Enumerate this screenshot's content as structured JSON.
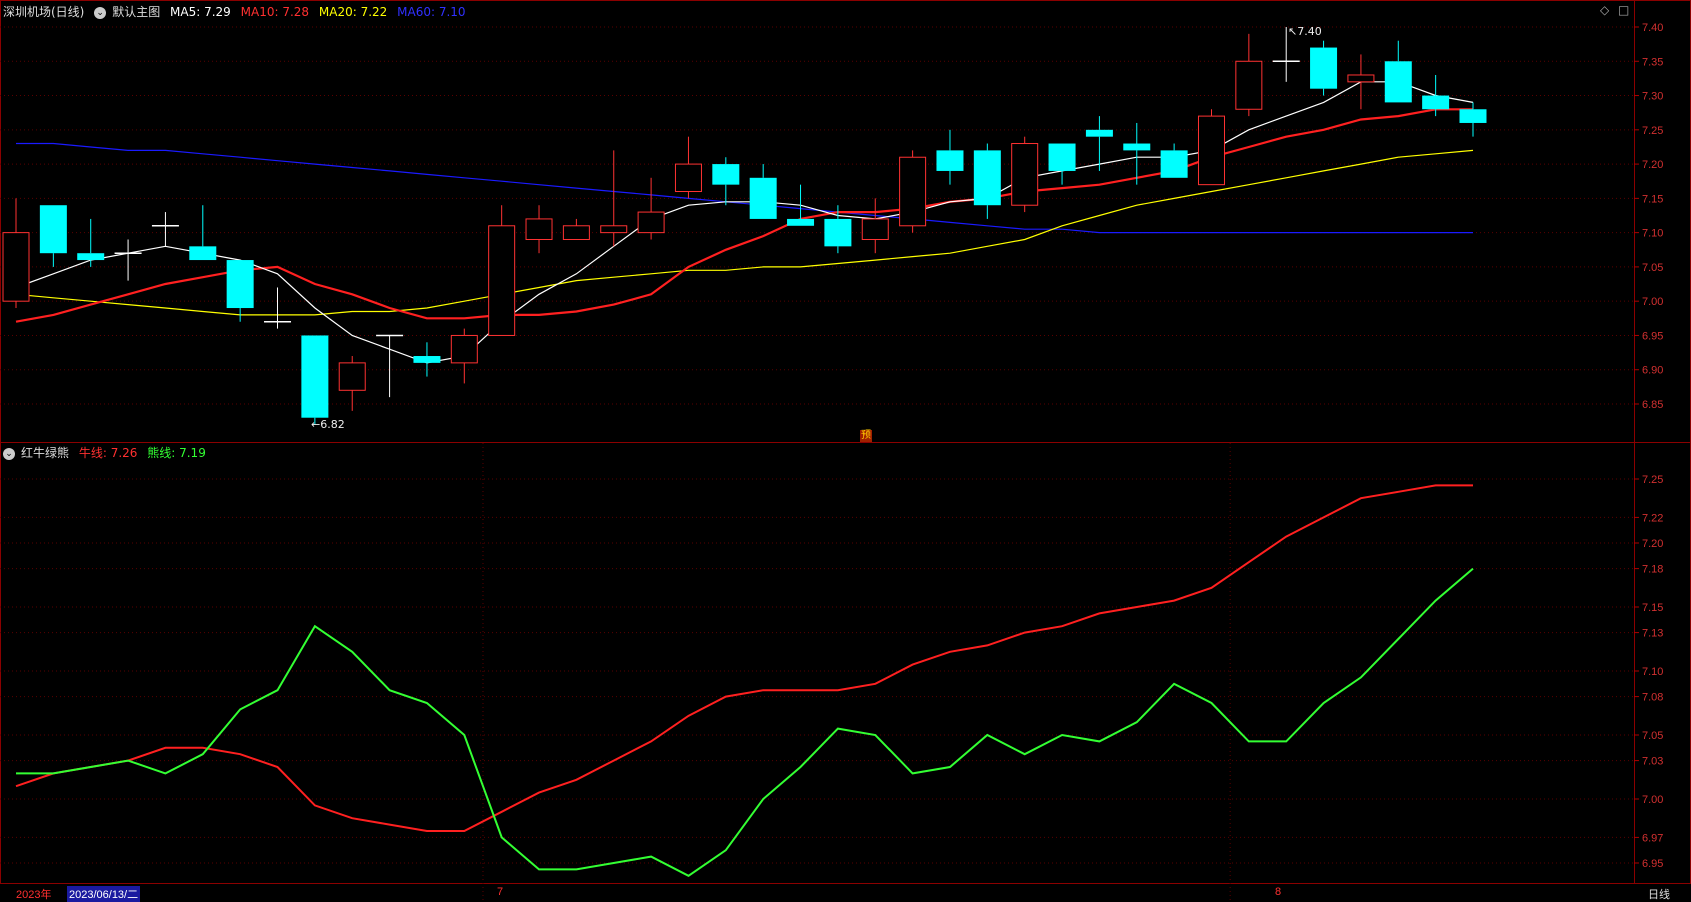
{
  "header_main": {
    "stock": "深圳机场(日线)",
    "template": "默认主图",
    "ma5": "MA5: 7.29",
    "ma10": "MA10: 7.28",
    "ma20": "MA20: 7.22",
    "ma60": "MA60: 7.10"
  },
  "header_sub": {
    "indicator": "红牛绿熊",
    "bull": "牛线: 7.26",
    "bear": "熊线: 7.19"
  },
  "annotations": {
    "high": "7.40",
    "low": "6.82",
    "pre": "预"
  },
  "footer": {
    "year": "2023年",
    "cursor_date": "2023/06/13/二",
    "month7": "7",
    "month8": "8",
    "period": "日线"
  },
  "chart_data": [
    {
      "type": "candlestick",
      "ylim": [
        6.8,
        7.43
      ],
      "yticks": [
        "7.40",
        "7.35",
        "7.30",
        "7.25",
        "7.20",
        "7.15",
        "7.10",
        "7.05",
        "7.00",
        "6.95",
        "6.90",
        "6.85"
      ],
      "colors": {
        "up": "#ff3232",
        "down": "#00ffff",
        "ma5": "#ffffff",
        "ma10": "#ff2020",
        "ma20": "#ffff00",
        "ma60": "#1a1aff"
      },
      "candles": [
        {
          "o": 7.0,
          "h": 7.15,
          "l": 6.99,
          "c": 7.1
        },
        {
          "o": 7.14,
          "h": 7.14,
          "l": 7.05,
          "c": 7.07
        },
        {
          "o": 7.07,
          "h": 7.12,
          "l": 7.05,
          "c": 7.06
        },
        {
          "o": 7.07,
          "h": 7.09,
          "l": 7.03,
          "c": 7.07
        },
        {
          "o": 7.11,
          "h": 7.13,
          "l": 7.08,
          "c": 7.11
        },
        {
          "o": 7.08,
          "h": 7.14,
          "l": 7.06,
          "c": 7.06
        },
        {
          "o": 7.06,
          "h": 7.06,
          "l": 6.97,
          "c": 6.99
        },
        {
          "o": 6.97,
          "h": 7.02,
          "l": 6.96,
          "c": 6.97
        },
        {
          "o": 6.95,
          "h": 6.95,
          "l": 6.82,
          "c": 6.83
        },
        {
          "o": 6.87,
          "h": 6.92,
          "l": 6.84,
          "c": 6.91
        },
        {
          "o": 6.95,
          "h": 6.95,
          "l": 6.86,
          "c": 6.95
        },
        {
          "o": 6.92,
          "h": 6.94,
          "l": 6.89,
          "c": 6.91
        },
        {
          "o": 6.91,
          "h": 6.96,
          "l": 6.88,
          "c": 6.95
        },
        {
          "o": 6.95,
          "h": 7.14,
          "l": 6.95,
          "c": 7.11
        },
        {
          "o": 7.09,
          "h": 7.14,
          "l": 7.07,
          "c": 7.12
        },
        {
          "o": 7.09,
          "h": 7.12,
          "l": 7.09,
          "c": 7.11
        },
        {
          "o": 7.1,
          "h": 7.22,
          "l": 7.08,
          "c": 7.11
        },
        {
          "o": 7.1,
          "h": 7.18,
          "l": 7.09,
          "c": 7.13
        },
        {
          "o": 7.16,
          "h": 7.24,
          "l": 7.15,
          "c": 7.2
        },
        {
          "o": 7.2,
          "h": 7.21,
          "l": 7.14,
          "c": 7.17
        },
        {
          "o": 7.18,
          "h": 7.2,
          "l": 7.12,
          "c": 7.12
        },
        {
          "o": 7.12,
          "h": 7.17,
          "l": 7.11,
          "c": 7.11
        },
        {
          "o": 7.12,
          "h": 7.14,
          "l": 7.07,
          "c": 7.08
        },
        {
          "o": 7.09,
          "h": 7.15,
          "l": 7.07,
          "c": 7.12
        },
        {
          "o": 7.11,
          "h": 7.22,
          "l": 7.1,
          "c": 7.21
        },
        {
          "o": 7.22,
          "h": 7.25,
          "l": 7.17,
          "c": 7.19
        },
        {
          "o": 7.22,
          "h": 7.23,
          "l": 7.12,
          "c": 7.14
        },
        {
          "o": 7.14,
          "h": 7.24,
          "l": 7.13,
          "c": 7.23
        },
        {
          "o": 7.23,
          "h": 7.23,
          "l": 7.17,
          "c": 7.19
        },
        {
          "o": 7.25,
          "h": 7.27,
          "l": 7.19,
          "c": 7.24
        },
        {
          "o": 7.23,
          "h": 7.26,
          "l": 7.17,
          "c": 7.22
        },
        {
          "o": 7.22,
          "h": 7.23,
          "l": 7.18,
          "c": 7.18
        },
        {
          "o": 7.17,
          "h": 7.28,
          "l": 7.17,
          "c": 7.27
        },
        {
          "o": 7.28,
          "h": 7.39,
          "l": 7.27,
          "c": 7.35
        },
        {
          "o": 7.35,
          "h": 7.4,
          "l": 7.32,
          "c": 7.35
        },
        {
          "o": 7.37,
          "h": 7.38,
          "l": 7.3,
          "c": 7.31
        },
        {
          "o": 7.32,
          "h": 7.36,
          "l": 7.28,
          "c": 7.33
        },
        {
          "o": 7.35,
          "h": 7.38,
          "l": 7.29,
          "c": 7.29
        },
        {
          "o": 7.3,
          "h": 7.33,
          "l": 7.27,
          "c": 7.28
        },
        {
          "o": 7.28,
          "h": 7.29,
          "l": 7.24,
          "c": 7.26
        }
      ],
      "ma5": [
        7.02,
        7.04,
        7.06,
        7.07,
        7.08,
        7.07,
        7.06,
        7.04,
        6.99,
        6.95,
        6.93,
        6.91,
        6.92,
        6.97,
        7.01,
        7.04,
        7.08,
        7.12,
        7.14,
        7.145,
        7.145,
        7.14,
        7.125,
        7.12,
        7.13,
        7.145,
        7.15,
        7.18,
        7.19,
        7.2,
        7.21,
        7.21,
        7.22,
        7.25,
        7.27,
        7.29,
        7.32,
        7.32,
        7.3,
        7.29
      ],
      "ma10": [
        6.97,
        6.98,
        6.995,
        7.01,
        7.025,
        7.035,
        7.045,
        7.05,
        7.025,
        7.01,
        6.99,
        6.975,
        6.975,
        6.98,
        6.98,
        6.985,
        6.995,
        7.01,
        7.05,
        7.075,
        7.095,
        7.12,
        7.13,
        7.13,
        7.135,
        7.145,
        7.15,
        7.16,
        7.165,
        7.17,
        7.18,
        7.19,
        7.21,
        7.225,
        7.24,
        7.25,
        7.265,
        7.27,
        7.28,
        7.28
      ],
      "ma20": [
        7.01,
        7.005,
        7.0,
        6.995,
        6.99,
        6.985,
        6.98,
        6.98,
        6.98,
        6.985,
        6.985,
        6.99,
        7.0,
        7.01,
        7.02,
        7.03,
        7.035,
        7.04,
        7.045,
        7.045,
        7.05,
        7.05,
        7.055,
        7.06,
        7.065,
        7.07,
        7.08,
        7.09,
        7.11,
        7.125,
        7.14,
        7.15,
        7.16,
        7.17,
        7.18,
        7.19,
        7.2,
        7.21,
        7.215,
        7.22
      ],
      "ma60": [
        7.23,
        7.23,
        7.225,
        7.22,
        7.22,
        7.215,
        7.21,
        7.205,
        7.2,
        7.195,
        7.19,
        7.185,
        7.18,
        7.175,
        7.17,
        7.165,
        7.16,
        7.155,
        7.15,
        7.145,
        7.14,
        7.135,
        7.13,
        7.125,
        7.12,
        7.115,
        7.11,
        7.105,
        7.105,
        7.1,
        7.1,
        7.1,
        7.1,
        7.1,
        7.1,
        7.1,
        7.1,
        7.1,
        7.1,
        7.1
      ]
    },
    {
      "type": "line",
      "ylim": [
        6.93,
        7.28
      ],
      "yticks": [
        "7.25",
        "7.22",
        "7.20",
        "7.18",
        "7.15",
        "7.13",
        "7.10",
        "7.08",
        "7.05",
        "7.03",
        "7.00",
        "6.97",
        "6.95"
      ],
      "series": [
        {
          "name": "牛线",
          "color": "#ff2020",
          "values": [
            7.01,
            7.02,
            7.025,
            7.03,
            7.04,
            7.04,
            7.035,
            7.025,
            6.995,
            6.985,
            6.98,
            6.975,
            6.975,
            6.99,
            7.005,
            7.015,
            7.03,
            7.045,
            7.065,
            7.08,
            7.085,
            7.085,
            7.085,
            7.09,
            7.105,
            7.115,
            7.12,
            7.13,
            7.135,
            7.145,
            7.15,
            7.155,
            7.165,
            7.185,
            7.205,
            7.22,
            7.235,
            7.24,
            7.245,
            7.245
          ]
        },
        {
          "name": "熊线",
          "color": "#33ff33",
          "values": [
            7.02,
            7.02,
            7.025,
            7.03,
            7.02,
            7.035,
            7.07,
            7.085,
            7.135,
            7.115,
            7.085,
            7.075,
            7.05,
            6.97,
            6.945,
            6.945,
            6.95,
            6.955,
            6.94,
            6.96,
            7.0,
            7.025,
            7.055,
            7.05,
            7.02,
            7.025,
            7.05,
            7.035,
            7.05,
            7.045,
            7.06,
            7.09,
            7.075,
            7.045,
            7.045,
            7.075,
            7.095,
            7.125,
            7.155,
            7.18
          ]
        }
      ]
    }
  ]
}
